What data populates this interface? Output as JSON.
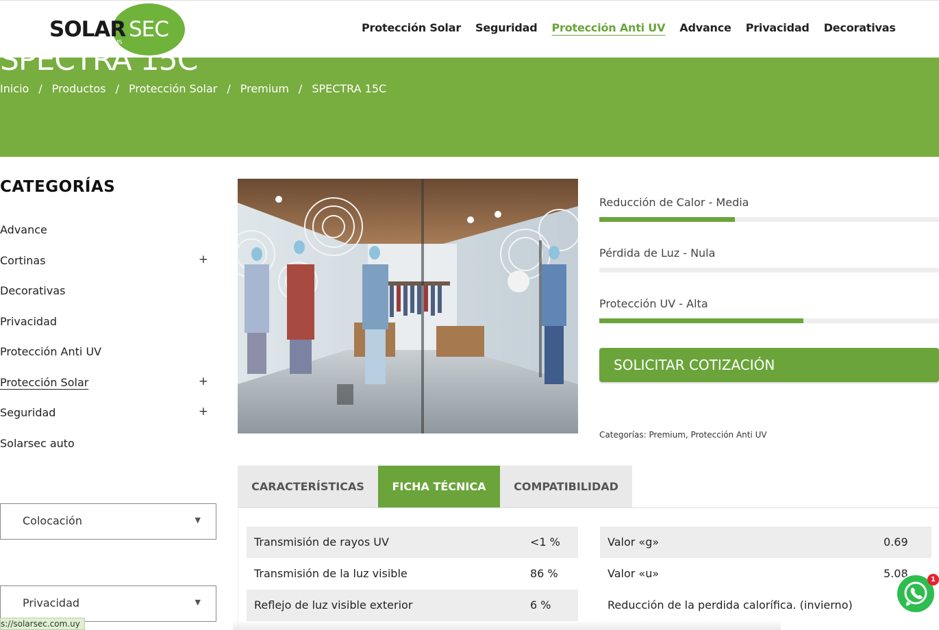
{
  "header": {
    "logo_solar": "SOLAR",
    "logo_sec": "SEC",
    "logo_sub": "WINDOW FILMS",
    "nav": [
      {
        "label": "Protección Solar",
        "active": false
      },
      {
        "label": "Seguridad",
        "active": false
      },
      {
        "label": "Protección Anti UV",
        "active": true
      },
      {
        "label": "Advance",
        "active": false
      },
      {
        "label": "Privacidad",
        "active": false
      },
      {
        "label": "Decorativas",
        "active": false
      }
    ]
  },
  "banner": {
    "title": "SPECTRA 15C",
    "breadcrumb": [
      "Inicio",
      "/",
      "Productos",
      "/",
      "Protección Solar",
      "/",
      "Premium",
      "/",
      "SPECTRA 15C"
    ]
  },
  "sidebar": {
    "title": "CATEGORÍAS",
    "items": [
      {
        "label": "Advance",
        "expandable": ""
      },
      {
        "label": "Cortinas",
        "expandable": "+"
      },
      {
        "label": "Decorativas",
        "expandable": ""
      },
      {
        "label": "Privacidad",
        "expandable": ""
      },
      {
        "label": "Protección Anti UV",
        "expandable": ""
      },
      {
        "label": "Protección Solar",
        "expandable": "+"
      },
      {
        "label": "Seguridad",
        "expandable": "+"
      },
      {
        "label": "Solarsec auto",
        "expandable": ""
      }
    ],
    "filters": [
      {
        "label": "Colocación",
        "arrow": "▼"
      },
      {
        "label": "Privacidad",
        "arrow": "▼"
      }
    ]
  },
  "product": {
    "image_alt": "clothing-store-storefront",
    "bars": [
      {
        "label": "Reducción de Calor - Media",
        "value": 0.4
      },
      {
        "label": "Pérdida de Luz - Nula",
        "value": 0.0
      },
      {
        "label": "Protección UV - Alta",
        "value": 0.6
      }
    ],
    "quote_button": "SOLICITAR COTIZACIÓN",
    "categories_meta": "Categorías: Premium, Protección Anti UV"
  },
  "tabs": [
    {
      "label": "CARACTERÍSTICAS",
      "active": false
    },
    {
      "label": "FICHA TÉCNICA",
      "active": true
    },
    {
      "label": "COMPATIBILIDAD",
      "active": false
    }
  ],
  "specs_left": [
    {
      "key": "Transmisión de rayos UV",
      "value": "<1 %"
    },
    {
      "key": "Transmisión de la luz visible",
      "value": "86 %"
    },
    {
      "key": "Reflejo de luz visible exterior",
      "value": "6 %"
    }
  ],
  "specs_right": [
    {
      "key": "Valor «g»",
      "value": "0.69"
    },
    {
      "key": "Valor «u»",
      "value": "5.08"
    },
    {
      "key": "Reducción de la perdida calorífica. (invierno)",
      "value": ""
    }
  ],
  "whatsapp": {
    "badge": "1"
  },
  "status_bar": {
    "url": "s://solarsec.com.uy"
  },
  "colors": {
    "brand_green": "#6aa43a",
    "banner_green": "#78ad3f"
  }
}
